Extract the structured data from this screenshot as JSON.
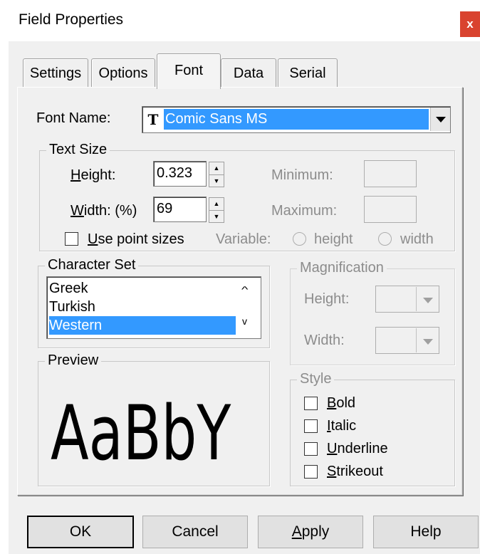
{
  "window": {
    "title": "Field Properties",
    "close_label": "x"
  },
  "tabs": [
    {
      "label": "Settings"
    },
    {
      "label": "Options"
    },
    {
      "label": "Font"
    },
    {
      "label": "Data"
    },
    {
      "label": "Serial"
    }
  ],
  "font": {
    "name_label": "Font Name:",
    "name_value": "Comic Sans MS",
    "name_icon_text": "T"
  },
  "text_size": {
    "legend": "Text Size",
    "height_label_rest": "eight:",
    "height_value": "0.323",
    "width_label_rest": "idth: (%)",
    "width_value": "69",
    "minimum_label": "Minimum:",
    "maximum_label": "Maximum:",
    "point_sizes_rest": "se point sizes",
    "variable_label": "Variable:",
    "radio_height": "height",
    "radio_width": "width"
  },
  "character_set": {
    "legend": "Character Set",
    "items": [
      "Greek",
      "Turkish",
      "Western"
    ]
  },
  "magnification": {
    "legend": "Magnification",
    "height_label": "Height:",
    "width_label": "Width:"
  },
  "preview": {
    "legend": "Preview",
    "sample": "AaBbY"
  },
  "style": {
    "legend": "Style",
    "bold_rest": "old",
    "italic_rest": "talic",
    "underline_rest": "nderline",
    "strikeout_rest": "trikeout"
  },
  "buttons": {
    "ok": "OK",
    "cancel": "Cancel",
    "apply_rest": "pply",
    "help": "Help"
  },
  "colors": {
    "selection": "#3399ff",
    "close": "#d9432f"
  }
}
